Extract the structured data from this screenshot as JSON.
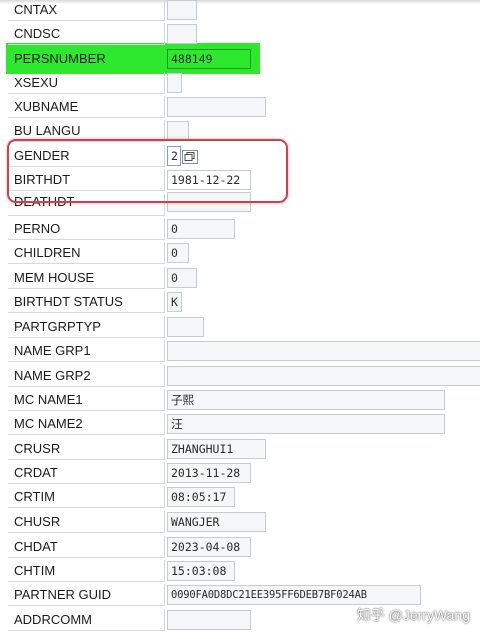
{
  "form": {
    "rows": [
      {
        "label": "CNTAX",
        "value": ""
      },
      {
        "label": "CNDSC",
        "value": ""
      },
      {
        "label": "PERSNUMBER",
        "value": "488149"
      },
      {
        "label": "XSEXU",
        "value": ""
      },
      {
        "label": "XUBNAME",
        "value": ""
      },
      {
        "label": "BU LANGU",
        "value": ""
      },
      {
        "label": "GENDER",
        "value": "2"
      },
      {
        "label": "BIRTHDT",
        "value": "1981-12-22"
      },
      {
        "label": "DEATHDT",
        "value": ""
      },
      {
        "label": "PERNO",
        "value": "0"
      },
      {
        "label": "CHILDREN",
        "value": "0"
      },
      {
        "label": "MEM HOUSE",
        "value": "0"
      },
      {
        "label": "BIRTHDT STATUS",
        "value": "K"
      },
      {
        "label": "PARTGRPTYP",
        "value": ""
      },
      {
        "label": "NAME GRP1",
        "value": ""
      },
      {
        "label": "NAME GRP2",
        "value": ""
      },
      {
        "label": "MC NAME1",
        "value": "子熙"
      },
      {
        "label": "MC NAME2",
        "value": "汪"
      },
      {
        "label": "CRUSR",
        "value": "ZHANGHUI1"
      },
      {
        "label": "CRDAT",
        "value": "2013-11-28"
      },
      {
        "label": "CRTIM",
        "value": "08:05:17"
      },
      {
        "label": "CHUSR",
        "value": "WANGJER"
      },
      {
        "label": "CHDAT",
        "value": "2023-04-08"
      },
      {
        "label": "CHTIM",
        "value": "15:03:08"
      },
      {
        "label": "PARTNER GUID",
        "value": "0090FA0D8DC21EE395FF6DEB7BF024AB"
      },
      {
        "label": "ADDRCOMM",
        "value": ""
      }
    ]
  },
  "highlight": {
    "color": "#2ee82e",
    "row": "PERSNUMBER"
  },
  "annotation": {
    "color": "#c8444d",
    "rows": [
      "GENDER",
      "BIRTHDT"
    ]
  },
  "watermark": "知乎 @JerryWang"
}
